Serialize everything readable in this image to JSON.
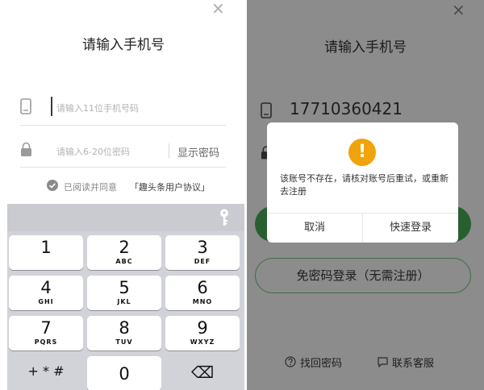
{
  "left": {
    "close_glyph": "×",
    "title": "请输入手机号",
    "phone_placeholder": "请输入11位手机号码",
    "password_placeholder": "请输入6-20位密码",
    "show_password": "显示密码",
    "agreement_prefix": "已阅读并同意",
    "agreement_link": "「趣头条用户协议」",
    "keypad": {
      "keys": [
        {
          "digit": "1",
          "letters": ""
        },
        {
          "digit": "2",
          "letters": "ABC"
        },
        {
          "digit": "3",
          "letters": "DEF"
        },
        {
          "digit": "4",
          "letters": "GHI"
        },
        {
          "digit": "5",
          "letters": "JKL"
        },
        {
          "digit": "6",
          "letters": "MNO"
        },
        {
          "digit": "7",
          "letters": "PQRS"
        },
        {
          "digit": "8",
          "letters": "TUV"
        },
        {
          "digit": "9",
          "letters": "WXYZ"
        }
      ],
      "symbols_label": "+ * #",
      "zero": "0",
      "delete_glyph": "⌫"
    }
  },
  "right": {
    "close_glyph": "×",
    "title": "请输入手机号",
    "phone_value": "17710360421",
    "dialog": {
      "alert_glyph": "!",
      "message": "该账号不存在，请核对账号后重试，或重新去注册",
      "cancel": "取消",
      "quick_login": "快速登录"
    },
    "passwordless_button": "免密码登录（无需注册）",
    "find_password": "找回密码",
    "contact_support": "联系客服"
  },
  "colors": {
    "accent_green": "#2f8a3e",
    "alert_orange": "#f0a30a",
    "overlay_gray": "#8c8c8c"
  }
}
